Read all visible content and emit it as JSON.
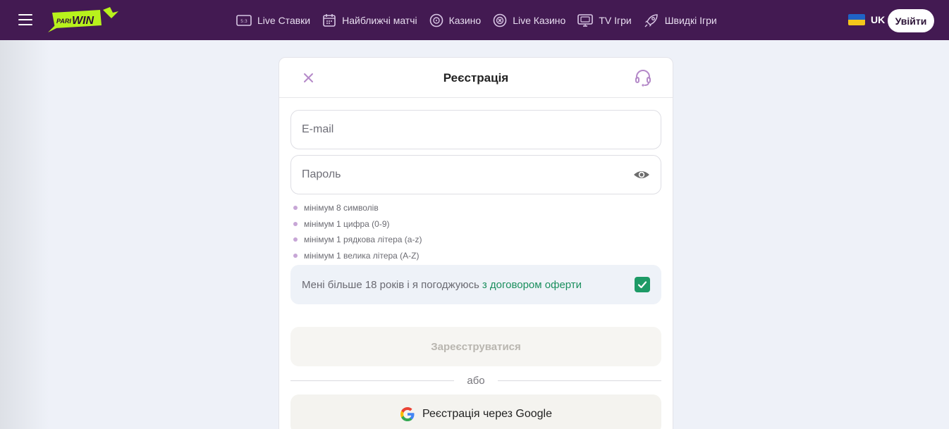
{
  "header": {
    "logo_text": "PARIWIN",
    "nav": [
      {
        "label": "Live Ставки",
        "icon": "scoreboard-icon"
      },
      {
        "label": "Найближчі матчі",
        "icon": "calendar-icon"
      },
      {
        "label": "Казино",
        "icon": "casino-chip-icon"
      },
      {
        "label": "Live Казино",
        "icon": "live-casino-icon"
      },
      {
        "label": "TV Ігри",
        "icon": "tv-icon"
      },
      {
        "label": "Швидкі Ігри",
        "icon": "rocket-icon"
      }
    ],
    "language": "UK",
    "login_label": "Увійти"
  },
  "modal": {
    "title": "Реєстрація",
    "email_placeholder": "E-mail",
    "password_placeholder": "Пароль",
    "password_rules": [
      "мінімум 8 символів",
      "мінімум 1 цифра (0-9)",
      "мінімум 1 рядкова літера (a-z)",
      "мінімум 1 велика літера (A-Z)"
    ],
    "agree_text": "Мені більше 18 років і я погоджуюсь",
    "agree_link": "з договором оферти",
    "agree_checked": true,
    "register_label": "Зареєструватися",
    "divider_text": "або",
    "google_label": "Реєстрація через Google"
  },
  "colors": {
    "topbar": "#431a52",
    "accent_green": "#1d9a66",
    "logo_lime": "#b8f21c"
  }
}
